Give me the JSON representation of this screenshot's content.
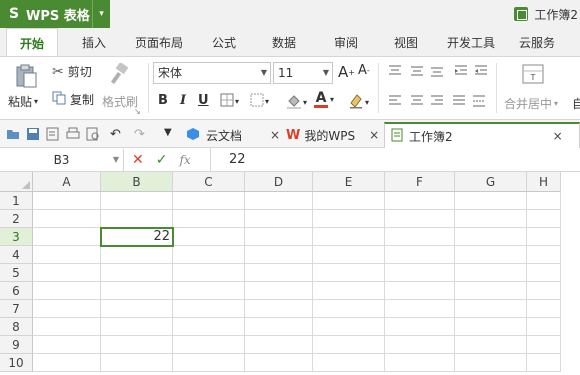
{
  "app": {
    "logo": "S",
    "name": "WPS 表格",
    "window_title": "工作簿2"
  },
  "menu": [
    "开始",
    "插入",
    "页面布局",
    "公式",
    "数据",
    "审阅",
    "视图",
    "开发工具",
    "云服务"
  ],
  "ribbon": {
    "paste": "粘贴",
    "cut": "剪切",
    "copy": "复制",
    "format_painter": "格式刷",
    "font_name": "宋体",
    "font_size": "11",
    "bold": "B",
    "italic": "I",
    "underline": "U",
    "merge_center": "合并居中",
    "auto": "自"
  },
  "doc_tabs": [
    {
      "label": "云文档"
    },
    {
      "label": "我的WPS"
    },
    {
      "label": "工作簿2"
    }
  ],
  "formula_bar": {
    "cell_ref": "B3",
    "fx": "fx",
    "value": "22"
  },
  "columns": [
    "A",
    "B",
    "C",
    "D",
    "E",
    "F",
    "G",
    "H"
  ],
  "rows": [
    "1",
    "2",
    "3",
    "4",
    "5",
    "6",
    "7",
    "8",
    "9",
    "10"
  ],
  "cells": {
    "B3": "22"
  },
  "colors": {
    "brand_green": "#4a8a32",
    "cancel_red": "#d9402b",
    "confirm_green": "#3c8c2d",
    "font_red": "#e03a2a"
  }
}
